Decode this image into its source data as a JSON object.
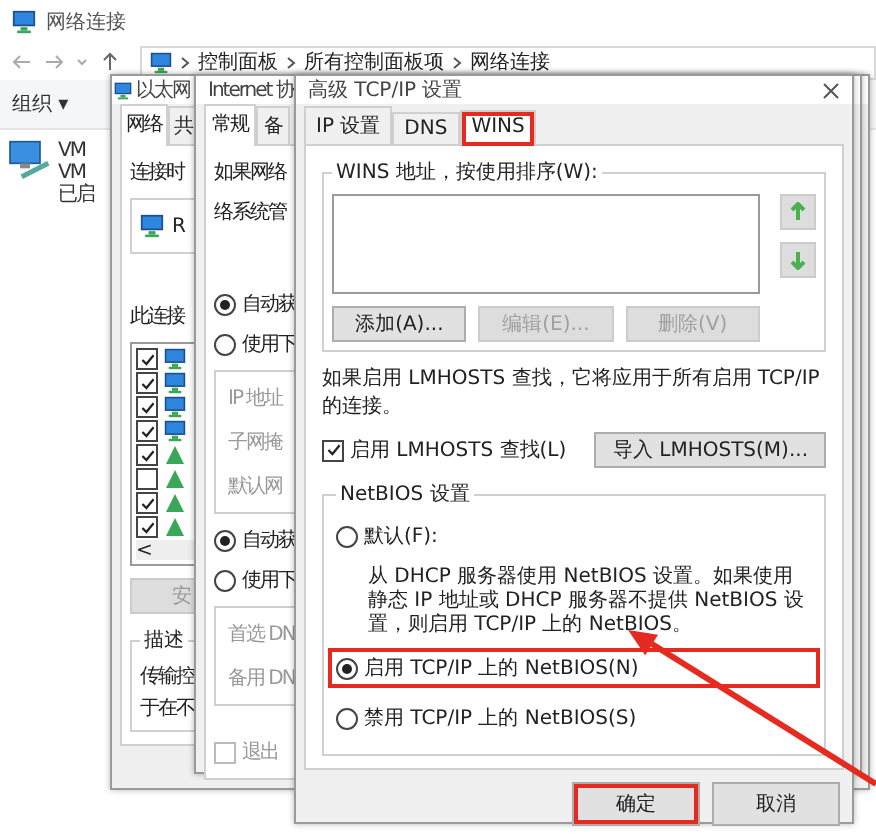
{
  "explorer": {
    "title": "网络连接",
    "breadcrumb": [
      "控制面板",
      "所有控制面板项",
      "网络连接"
    ],
    "organize": "组织 ▾",
    "adapter_lines": [
      "VM",
      "VM",
      "已启"
    ]
  },
  "ethernet_dialog": {
    "title": "以太网",
    "tabs": [
      {
        "label": "网络",
        "selected": true
      },
      {
        "label": "共",
        "selected": false
      }
    ],
    "connect_using": "连接时",
    "adapter": "R",
    "items_label": "此连接",
    "items": [
      {
        "kind": "client",
        "checked": true
      },
      {
        "kind": "client",
        "checked": true
      },
      {
        "kind": "client",
        "checked": true
      },
      {
        "kind": "client",
        "checked": true
      },
      {
        "kind": "protocol",
        "checked": true
      },
      {
        "kind": "protocol",
        "checked": false
      },
      {
        "kind": "protocol",
        "checked": true
      },
      {
        "kind": "protocol",
        "checked": true
      }
    ],
    "scroll_left": "<",
    "button": "安",
    "description_title": "描述",
    "description_lines": [
      "传输控",
      "于在不"
    ]
  },
  "ipv4_dialog": {
    "title": "Internet 协",
    "tabs": [
      {
        "label": "常规",
        "selected": true
      },
      {
        "label": "备",
        "selected": false
      }
    ],
    "intro_lines": [
      "如果网络",
      "络系统管"
    ],
    "ip_options": [
      {
        "label": "自动获",
        "selected": true
      },
      {
        "label": "使用下",
        "selected": false
      }
    ],
    "ip_fields": [
      "IP 地址",
      "子网掩",
      "默认网"
    ],
    "dns_options": [
      {
        "label": "自动获",
        "selected": true
      },
      {
        "label": "使用下",
        "selected": false
      }
    ],
    "dns_fields": [
      "首选 DN",
      "备用 DN"
    ],
    "exit_check": {
      "label": "退出",
      "checked": false
    }
  },
  "advanced_dialog": {
    "title": "高级 TCP/IP 设置",
    "tabs": [
      {
        "label": "IP 设置",
        "selected": false,
        "highlighted": false
      },
      {
        "label": "DNS",
        "selected": false,
        "highlighted": false
      },
      {
        "label": "WINS",
        "selected": true,
        "highlighted": true
      }
    ],
    "wins_label": "WINS 地址，按使用排序(W):",
    "wins_buttons": [
      {
        "label": "添加(A)...",
        "disabled": false
      },
      {
        "label": "编辑(E)...",
        "disabled": true
      },
      {
        "label": "删除(V)",
        "disabled": true
      }
    ],
    "lmhosts_note": "如果启用 LMHOSTS 查找，它将应用于所有启用 TCP/IP 的连接。",
    "lmhosts": {
      "label": "启用 LMHOSTS 查找(L)",
      "checked": true
    },
    "import_button": "导入 LMHOSTS(M)...",
    "netbios_label": "NetBIOS 设置",
    "netbios_options": [
      {
        "label": "默认(F):",
        "selected": false,
        "highlighted": false,
        "description": "从 DHCP 服务器使用 NetBIOS 设置。如果使用静态 IP 地址或 DHCP 服务器不提供 NetBIOS 设置，则启用 TCP/IP 上的 NetBIOS。"
      },
      {
        "label": "启用 TCP/IP 上的 NetBIOS(N)",
        "selected": true,
        "highlighted": true
      },
      {
        "label": "禁用 TCP/IP 上的 NetBIOS(S)",
        "selected": false,
        "highlighted": false
      }
    ],
    "footer_buttons": [
      {
        "label": "确定",
        "highlighted": true
      },
      {
        "label": "取消",
        "highlighted": false
      }
    ],
    "annotation_arrow": true
  }
}
